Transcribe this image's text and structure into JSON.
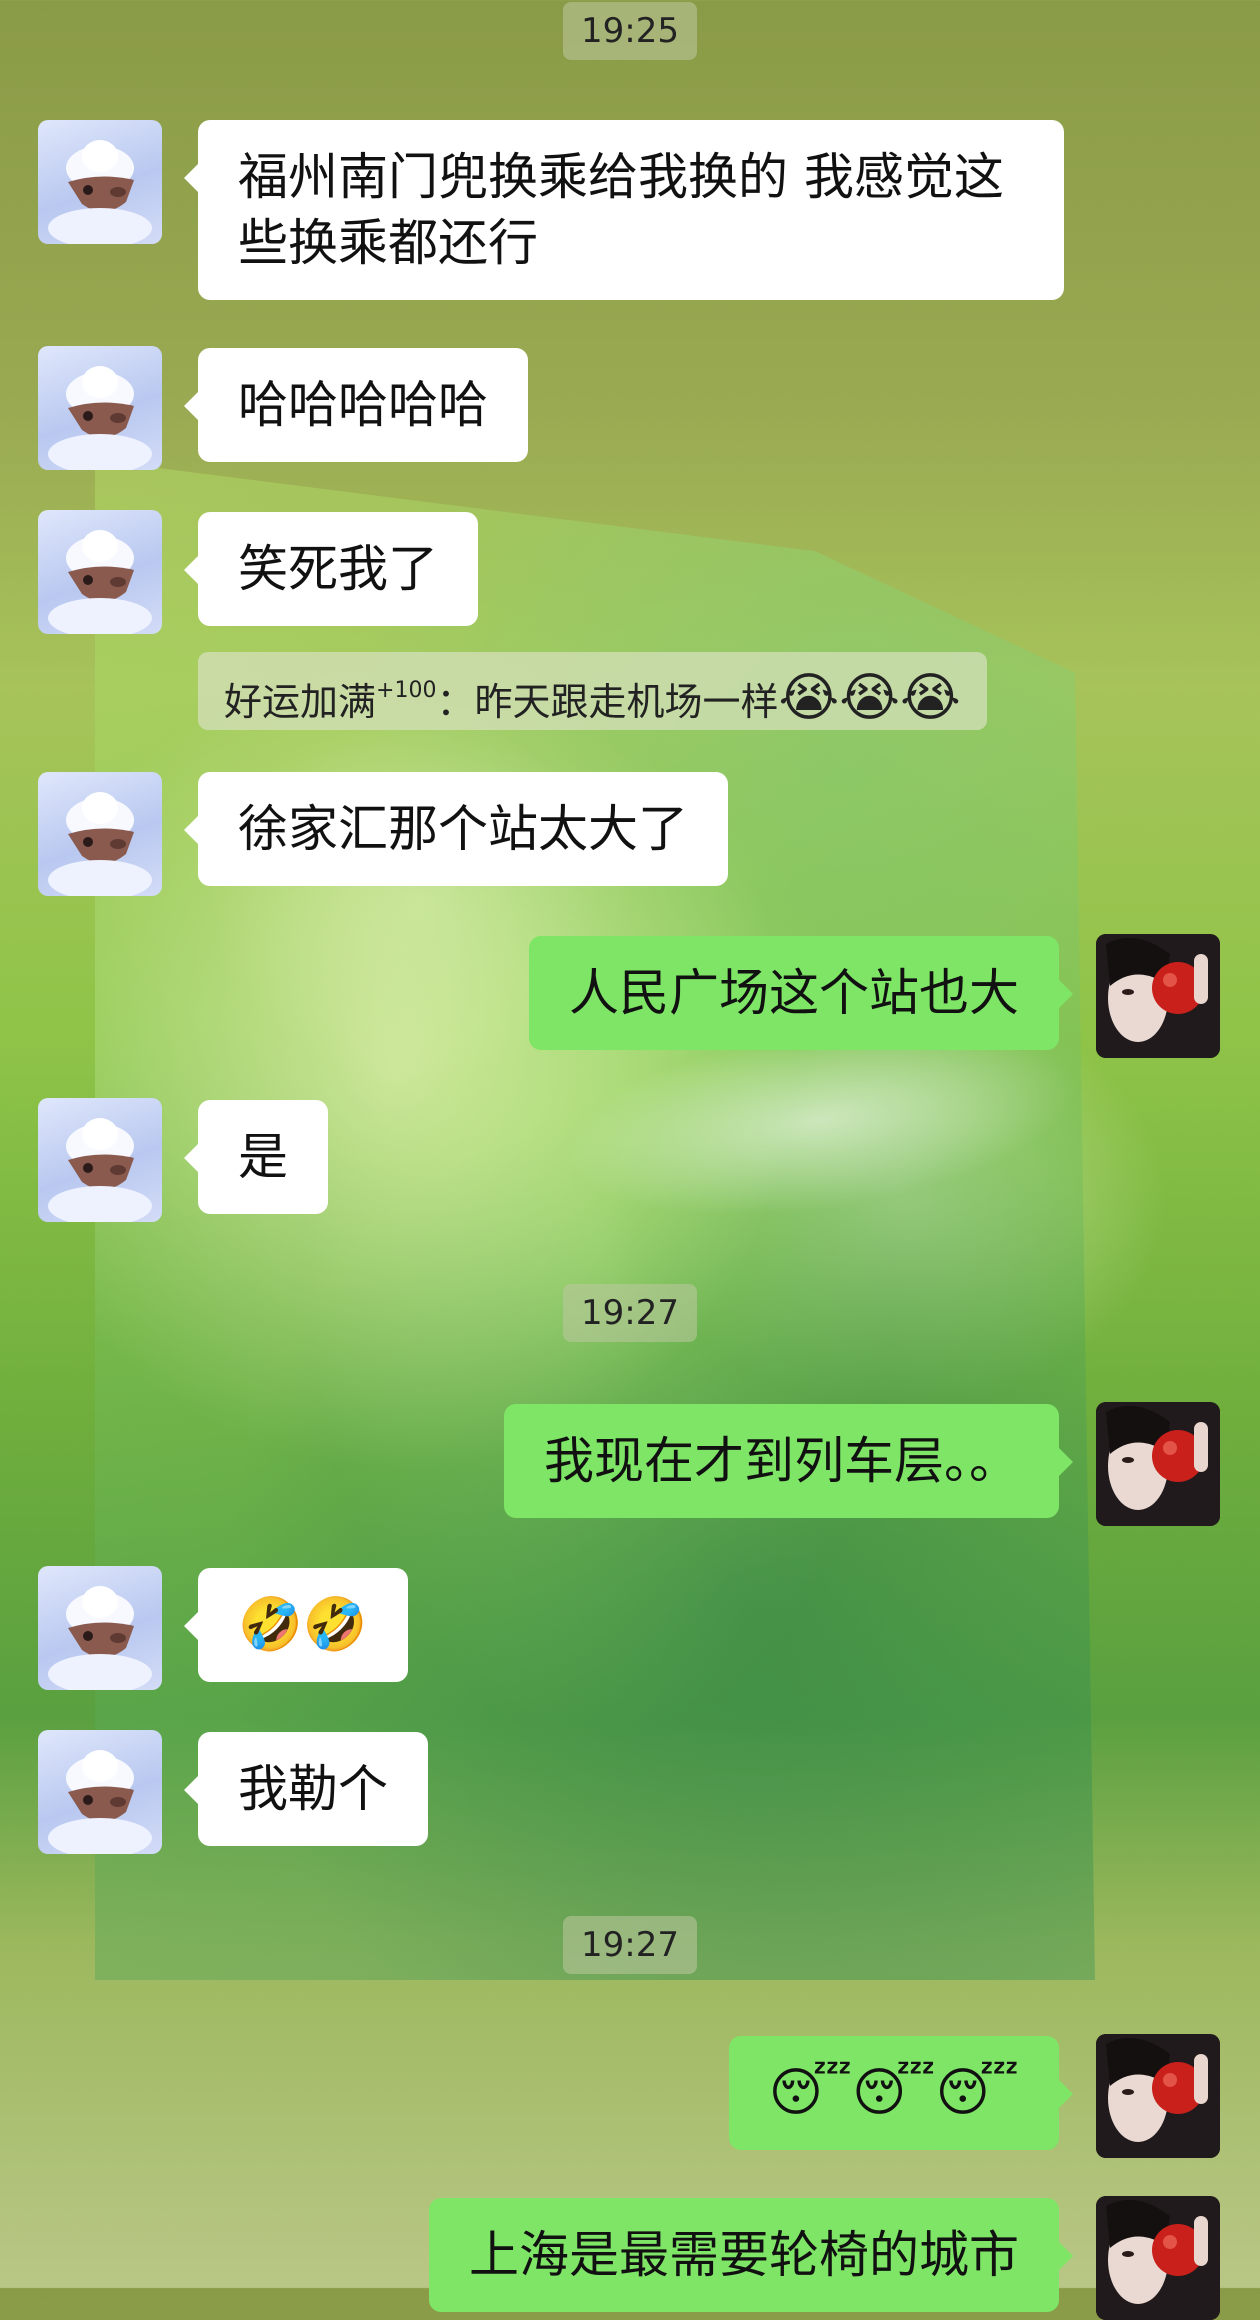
{
  "messages": [
    {
      "type": "time",
      "text": "19:25"
    },
    {
      "type": "in",
      "text": "福州南门兜换乘给我换的 我感觉这些换乘都还行"
    },
    {
      "type": "in",
      "text": "哈哈哈哈哈"
    },
    {
      "type": "in",
      "text": "笑死我了"
    },
    {
      "type": "quote",
      "sender": "好运加满",
      "badge": "+100",
      "separator": "：",
      "text": "昨天跟走机场一样",
      "emojis": "😭😭😭"
    },
    {
      "type": "in",
      "text": "徐家汇那个站太大了"
    },
    {
      "type": "out",
      "text": "人民广场这个站也大"
    },
    {
      "type": "in",
      "text": "是"
    },
    {
      "type": "time",
      "text": "19:27"
    },
    {
      "type": "out",
      "text": "我现在才到列车层。。"
    },
    {
      "type": "in",
      "text": "🤣🤣"
    },
    {
      "type": "in",
      "text": "我勒个"
    },
    {
      "type": "time",
      "text": "19:27"
    },
    {
      "type": "out",
      "text": "😴😴😴"
    },
    {
      "type": "out",
      "text": "上海是最需要轮椅的城市"
    }
  ],
  "avatars": {
    "contact": "deer-avatar-icon",
    "self": "girl-with-apple-avatar-icon"
  },
  "colors": {
    "bubble_in": "#ffffff",
    "bubble_out": "#7ee566",
    "time_bg": "#c2cba2"
  }
}
